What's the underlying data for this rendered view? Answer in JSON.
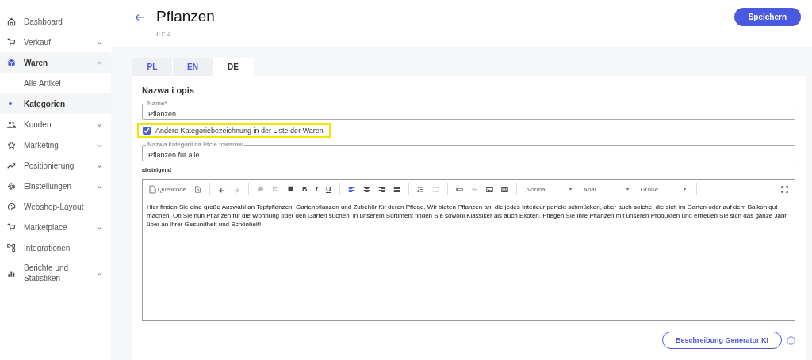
{
  "sidebar": {
    "items": [
      {
        "label": "Dashboard",
        "selected": false
      },
      {
        "label": "Verkauf",
        "selected": false,
        "expanded": false
      },
      {
        "label": "Waren",
        "selected": true,
        "expanded": true,
        "children": [
          {
            "label": "Alle Artikel",
            "selected": false
          },
          {
            "label": "Kategorien",
            "selected": true
          }
        ]
      },
      {
        "label": "Kunden",
        "selected": false,
        "expanded": false
      },
      {
        "label": "Marketing",
        "selected": false,
        "expanded": false
      },
      {
        "label": "Positionierung",
        "selected": false,
        "expanded": false
      },
      {
        "label": "Einstellungen",
        "selected": false,
        "expanded": false
      },
      {
        "label": "Webshop-Layout",
        "selected": false
      },
      {
        "label": "Marketplace",
        "selected": false,
        "expanded": false
      },
      {
        "label": "Integrationen",
        "selected": false
      },
      {
        "label": "Berichte und Statistiken",
        "selected": false,
        "expanded": false
      }
    ]
  },
  "header": {
    "title": "Pflanzen",
    "subtitle": "ID: 4",
    "save_button": "Speichern"
  },
  "tabs": [
    {
      "label": "PL",
      "selected": false
    },
    {
      "label": "EN",
      "selected": false
    },
    {
      "label": "DE",
      "selected": true
    }
  ],
  "section_title": "Nazwa i opis",
  "name_field": {
    "label": "Name*",
    "value": "Pflanzen"
  },
  "alt_name_checkbox": {
    "label": "Andere Kategoriebezeichnung in der Liste der Waren",
    "checked": true,
    "highlighted": true
  },
  "list_name_field": {
    "label": "Nazwa kategorii na liście towarów",
    "value": "Pflanzen für alle"
  },
  "sort_label": "absteigend",
  "editor": {
    "source_button": "Quellcode",
    "history": [
      {
        "disabled": false
      },
      {
        "disabled": true
      }
    ],
    "format_buttons": [
      "B",
      "I",
      "U"
    ],
    "align": [
      {
        "selected": true
      },
      {
        "selected": false
      },
      {
        "selected": false
      },
      {
        "selected": false
      }
    ],
    "dropdowns": [
      {
        "value": "Normal"
      },
      {
        "value": "Arial"
      },
      {
        "value": "Größe"
      }
    ],
    "text": "Hier finden Sie eine große Auswahl an Topfpflanzen, Gartenpflanzen und Zubehör für deren Pflege. Wir bieten Pflanzen an, die jedes Interieur perfekt schmücken, aber auch solche, die sich im Garten oder auf dem Balkon gut machen. Ob Sie nun Pflanzen für die Wohnung oder den Garten suchen, in unserem Sortiment finden Sie sowohl Klassiker als auch Exoten. Pflegen Sie Ihre Pflanzen mit unseren Produkten und erfreuen Sie sich das ganze Jahr über an ihrer Gesundheit und Schönheit!"
  },
  "generator_button": "Beschreibung Generator KI"
}
